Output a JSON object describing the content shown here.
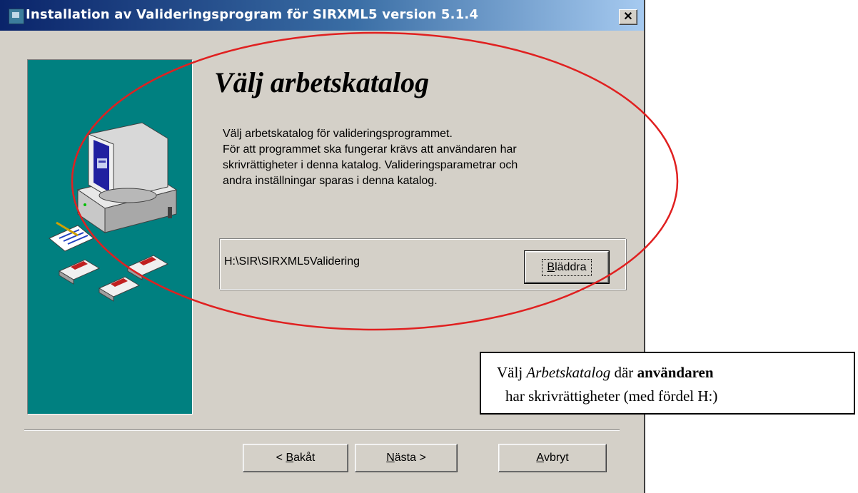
{
  "window": {
    "title": "Installation av Valideringsprogram för SIRXML5 version 5.1.4",
    "close_label": "✕"
  },
  "wizard": {
    "heading": "Välj arbetskatalog",
    "body_lines": [
      "Välj arbetskatalog för valideringsprogrammet.",
      "För att programmet ska fungerar krävs att användaren har",
      "skrivrättigheter i denna katalog. Valideringsparametrar och",
      "andra inställningar sparas i denna katalog."
    ],
    "directory_path": "H:\\SIR\\SIRXML5Validering",
    "browse_button": {
      "mnemonic": "B",
      "rest": "läddra"
    },
    "back_button": {
      "prefix": "< ",
      "mnemonic": "B",
      "rest": "akåt"
    },
    "next_button": {
      "mnemonic": "N",
      "rest": "ästa >"
    },
    "cancel_button": {
      "mnemonic": "A",
      "rest": "vbryt"
    }
  },
  "callout": {
    "line1_part1": "Välj ",
    "line1_italic": "Arbetskatalog",
    "line1_part2": " där ",
    "line1_bold": "användaren",
    "line2": "har skrivrättigheter (med fördel H:)"
  },
  "colors": {
    "dialog_bg": "#d4d0c8",
    "side_panel": "#008080",
    "title_bar": "#0a246a",
    "annotation": "#e02020"
  },
  "icons": [
    "installer-icon",
    "computer-icon",
    "document-pen-icon",
    "floppy-disk-icon"
  ]
}
